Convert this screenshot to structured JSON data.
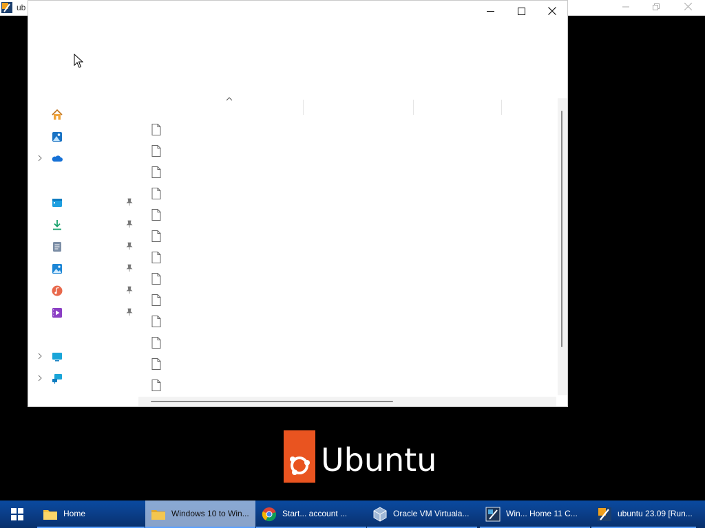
{
  "vbox": {
    "title": "ub",
    "controls": [
      "minimize",
      "restore",
      "close"
    ]
  },
  "explorer": {
    "window_controls": [
      "minimize",
      "maximize",
      "close"
    ],
    "nav_items": [
      {
        "icon": "home-icon",
        "expandable": false,
        "pinned": false
      },
      {
        "icon": "gallery-icon",
        "expandable": false,
        "pinned": false
      },
      {
        "icon": "onedrive-icon",
        "expandable": true,
        "pinned": false
      },
      {
        "icon": "desktop-folder-icon",
        "expandable": false,
        "pinned": true
      },
      {
        "icon": "downloads-icon",
        "expandable": false,
        "pinned": true
      },
      {
        "icon": "documents-icon",
        "expandable": false,
        "pinned": true
      },
      {
        "icon": "pictures-icon",
        "expandable": false,
        "pinned": true
      },
      {
        "icon": "music-icon",
        "expandable": false,
        "pinned": true
      },
      {
        "icon": "videos-icon",
        "expandable": false,
        "pinned": true
      },
      {
        "icon": "this-pc-icon",
        "expandable": true,
        "pinned": false
      },
      {
        "icon": "network-icon",
        "expandable": true,
        "pinned": false
      }
    ],
    "file_count": 13
  },
  "ubuntu_splash": {
    "wordmark": "Ubuntu",
    "brand_color": "#e95420"
  },
  "taskbar": {
    "items": [
      {
        "label": "Home",
        "icon": "file-explorer-icon"
      },
      {
        "label": "Windows 10 to Win...",
        "icon": "folder-icon",
        "active": true
      },
      {
        "label": "Start... account ...",
        "icon": "chrome-icon"
      },
      {
        "label": "Oracle VM Virtuala...",
        "icon": "virtualbox-icon"
      },
      {
        "label": "Win... Home 11 C...",
        "icon": "vm-icon"
      },
      {
        "label": "ubuntu 23.09 [Run...",
        "icon": "virtualbox-vm-icon"
      }
    ]
  }
}
